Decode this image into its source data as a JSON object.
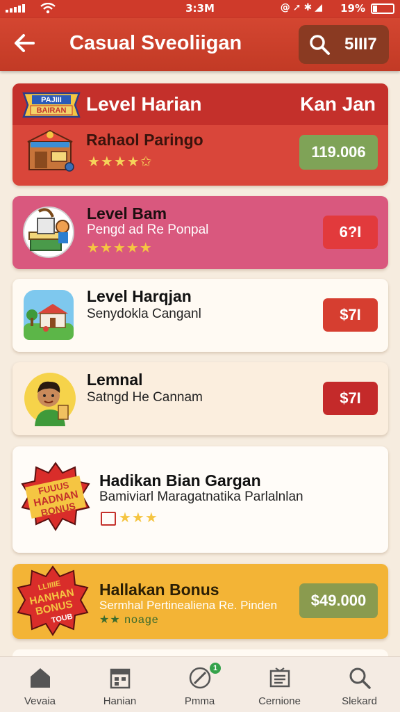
{
  "status_bar": {
    "time": "3:3M",
    "battery": "19%"
  },
  "app_bar": {
    "title": "Casual Sveoliigan",
    "search_value": "5III7"
  },
  "cards": [
    {
      "header_title": "Level Harian",
      "header_right": "Kan Jan",
      "badge_lines": [
        "PAJIII",
        "BAIRAN"
      ],
      "title": "Rahaol Paringo",
      "stars": "★★★★✩",
      "price": "119.006",
      "colors": {
        "bg": "#d9463a",
        "band": "#c4302b",
        "price": "#7fa357"
      }
    },
    {
      "title": "Level Bam",
      "subtitle": "Pengd ad Re Ponpal",
      "stars": "★★★★★",
      "price": "6?I",
      "colors": {
        "bg": "#d9587e",
        "price": "#e23a3c"
      }
    },
    {
      "title": "Level Harqjan",
      "subtitle": "Senydokla Canganl",
      "price": "$7I",
      "colors": {
        "bg": "#fffaf3",
        "price": "#d63e30"
      }
    },
    {
      "title": "Lemnal",
      "subtitle": "Satngd He Cannam",
      "price": "$7I",
      "colors": {
        "bg": "#fbeede",
        "price": "#c42a2a"
      }
    },
    {
      "badge_lines": [
        "FUUUS",
        "HADNAN",
        "BONUS"
      ],
      "title": "Hadikan Bian Gargan",
      "subtitle": "Bamiviarl Maragatnatika Parlalnlan",
      "stars": "★★★",
      "colors": {
        "bg": "#fffcf8"
      }
    },
    {
      "badge_lines": [
        "LLIIIIE",
        "HANHAN",
        "BONUS",
        "TOUB"
      ],
      "title": "Hallakan Bonus",
      "subtitle": "Sermhal Pertinealiena Re. Pinden",
      "stars": "★★ noage",
      "price": "$49.000",
      "colors": {
        "bg": "#f3b436",
        "price": "#8a9b4f"
      }
    }
  ],
  "tab_bar": {
    "tabs": [
      {
        "label": "Vevaia",
        "icon": "home-icon"
      },
      {
        "label": "Hanian",
        "icon": "calendar-icon"
      },
      {
        "label": "Pmma",
        "icon": "compass-icon",
        "badge": "1"
      },
      {
        "label": "Cernione",
        "icon": "list-icon"
      },
      {
        "label": "Slekard",
        "icon": "search-icon"
      }
    ]
  },
  "accent_color": "#cf3a2a"
}
